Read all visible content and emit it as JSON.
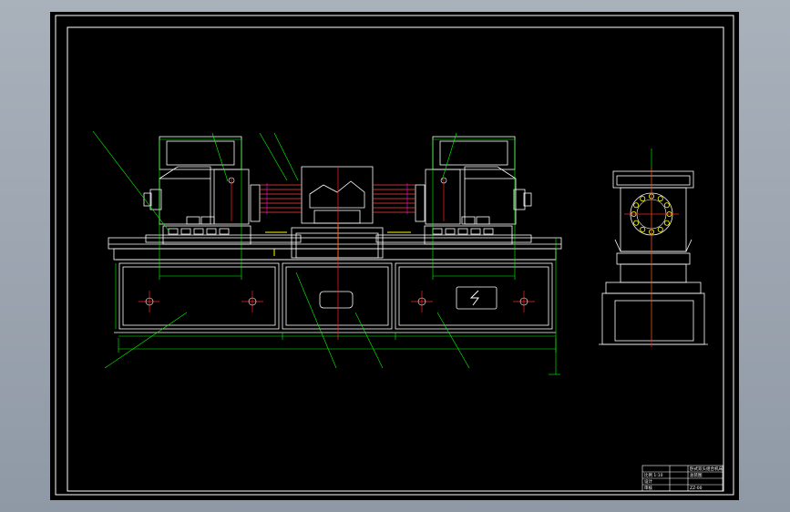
{
  "app": {
    "background_color": "#9aa3ae",
    "sheet_color": "#000000"
  },
  "drawing": {
    "colors": {
      "frame": "#ffffff",
      "outline": "#ffffff",
      "leader": "#00ff00",
      "dimension": "#00ff00",
      "centerline": "#ff0000",
      "component": "#ff4040",
      "accent": "#ffff00",
      "highlight": "#ff00ff"
    },
    "title_block": {
      "line1": "卧式双头组合机床",
      "line2": "总装图",
      "line3": "比例 1:10",
      "line4": "ZZ-00",
      "line5": "设计",
      "line6": "审核"
    }
  }
}
